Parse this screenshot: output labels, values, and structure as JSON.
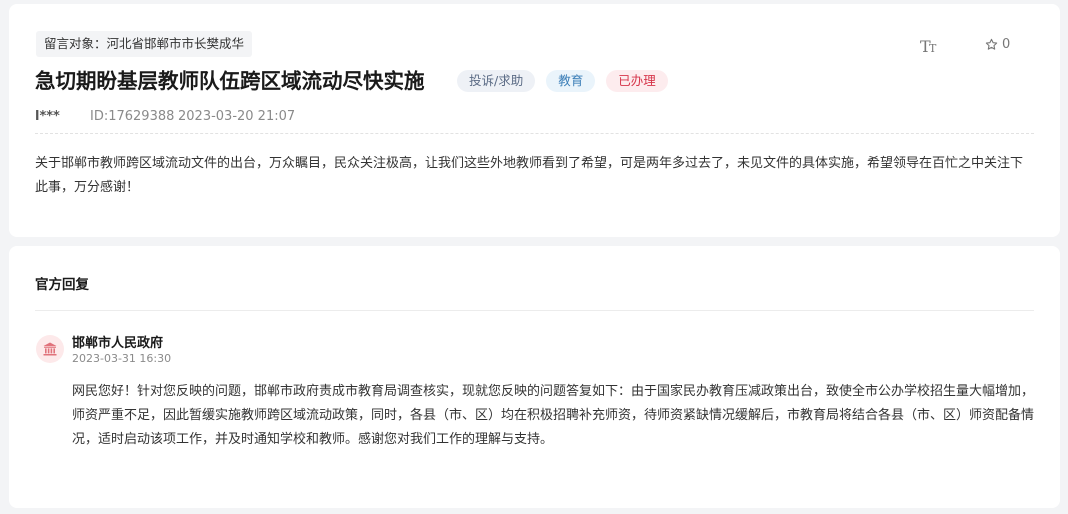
{
  "complaint": {
    "target_label": "留言对象：河北省邯郸市市长樊成华",
    "title": "急切期盼基层教师队伍跨区域流动尽快实施",
    "tags": {
      "type": "投诉/求助",
      "category": "教育",
      "status": "已办理"
    },
    "toolbar": {
      "font_size_icon": "text-size-icon",
      "favorite_icon": "star-icon",
      "favorite_count": "0"
    },
    "meta": {
      "user": "l***",
      "id": "ID:17629388",
      "time": "2023-03-20 21:07"
    },
    "content": "关于邯郸市教师跨区域流动文件的出台，万众瞩目，民众关注极高，让我们这些外地教师看到了希望，可是两年多过去了，未见文件的具体实施，希望领导在百忙之中关注下此事，万分感谢！"
  },
  "reply": {
    "heading": "官方回复",
    "org_icon": "government-building-icon",
    "org_name": "邯郸市人民政府",
    "time": "2023-03-31 16:30",
    "content": "网民您好！针对您反映的问题，邯郸市政府责成市教育局调查核实，现就您反映的问题答复如下：由于国家民办教育压减政策出台，致使全市公办学校招生量大幅增加，师资严重不足，因此暂缓实施教师跨区域流动政策，同时，各县（市、区）均在积极招聘补充师资，待师资紧缺情况缓解后，市教育局将结合各县（市、区）师资配备情况，适时启动该项工作，并及时通知学校和教师。感谢您对我们工作的理解与支持。"
  },
  "colors": {
    "status_red": "#d6354a",
    "category_blue": "#3c7fb8",
    "type_slate": "#5b6b85",
    "avatar_red": "#e0727b"
  }
}
